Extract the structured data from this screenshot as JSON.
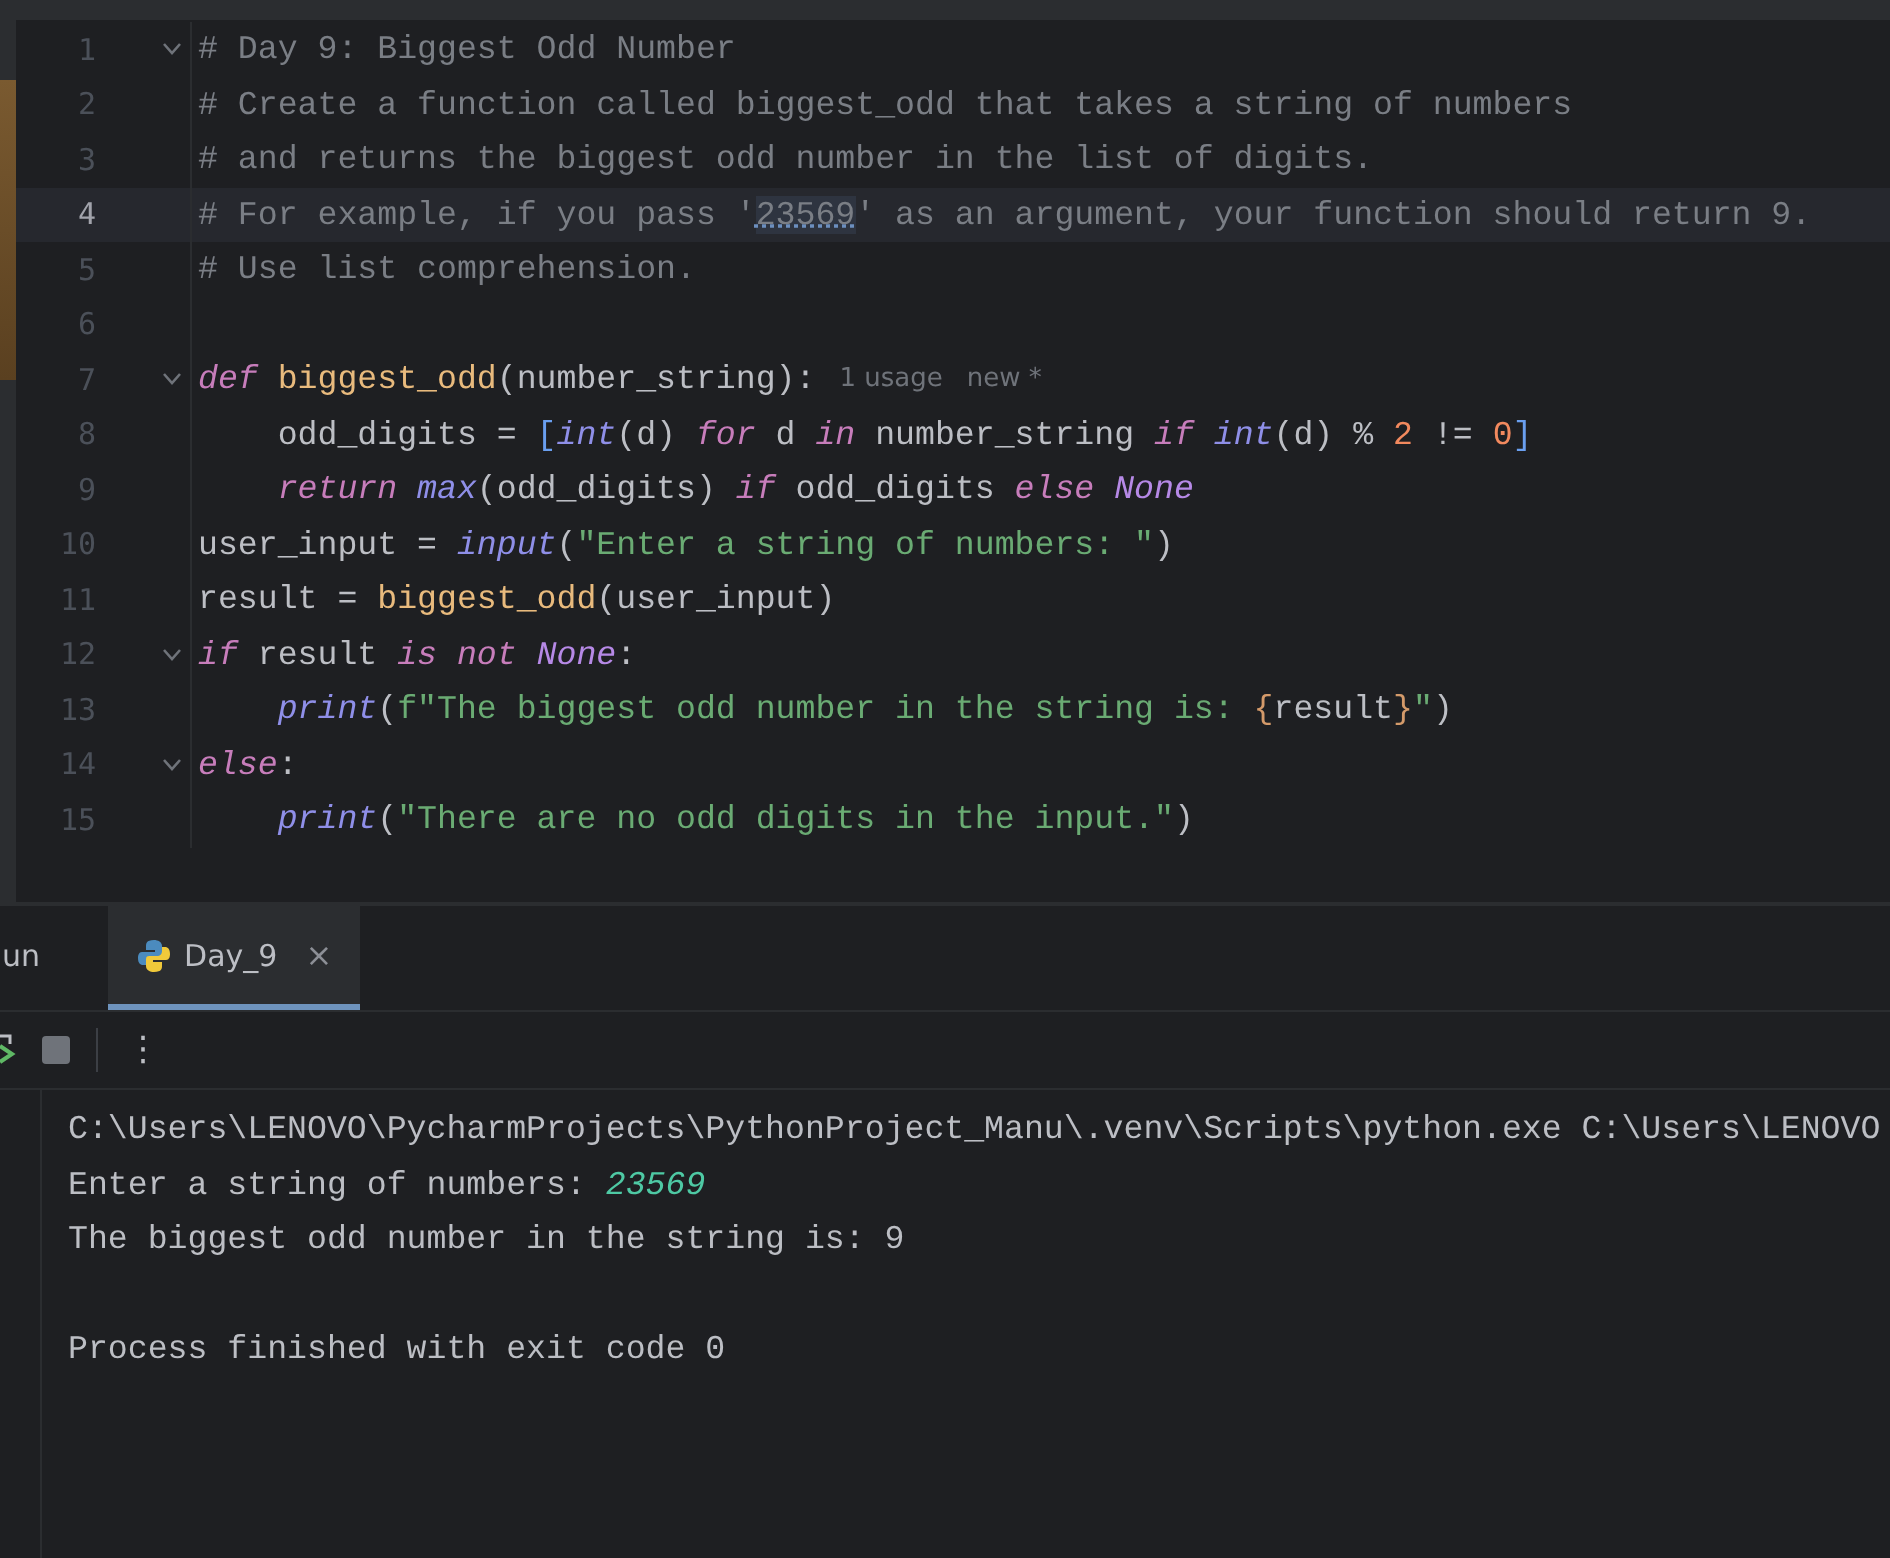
{
  "editor": {
    "lines": [
      {
        "number": "1",
        "fold": true,
        "current": false,
        "tokens": [
          {
            "kind": "comment",
            "text": "# Day 9: Biggest Odd Number"
          }
        ]
      },
      {
        "number": "2",
        "fold": false,
        "current": false,
        "tokens": [
          {
            "kind": "comment",
            "text": "# Create a function called biggest_odd that takes a string of numbers"
          }
        ]
      },
      {
        "number": "3",
        "fold": false,
        "current": false,
        "tokens": [
          {
            "kind": "comment",
            "text": "# and returns the biggest odd number in the list of digits."
          }
        ]
      },
      {
        "number": "4",
        "fold": false,
        "current": true,
        "tokens": [
          {
            "kind": "comment",
            "text": "# For example, if you pass '"
          },
          {
            "kind": "mark",
            "text": "23569"
          },
          {
            "kind": "comment",
            "text": "' as an argument, your function should return 9."
          }
        ]
      },
      {
        "number": "5",
        "fold": false,
        "current": false,
        "tokens": [
          {
            "kind": "comment",
            "text": "# Use list comprehension."
          }
        ]
      },
      {
        "number": "6",
        "fold": false,
        "current": false
      },
      {
        "number": "7",
        "fold": true,
        "current": false,
        "tokens": [
          {
            "kind": "keyword",
            "text": "def "
          },
          {
            "kind": "funcname",
            "text": "biggest_odd"
          },
          {
            "kind": "plain",
            "text": "(number_string):"
          }
        ],
        "hints": [
          "1 usage",
          "new *"
        ]
      },
      {
        "number": "8",
        "fold": false,
        "current": false,
        "indented": true,
        "tokens": [
          {
            "kind": "plain",
            "text": "odd_digits = "
          },
          {
            "kind": "bracket",
            "text": "["
          },
          {
            "kind": "builtin",
            "text": "int"
          },
          {
            "kind": "plain",
            "text": "(d) "
          },
          {
            "kind": "keyword",
            "text": "for"
          },
          {
            "kind": "plain",
            "text": " d "
          },
          {
            "kind": "keyword",
            "text": "in"
          },
          {
            "kind": "plain",
            "text": " number_string "
          },
          {
            "kind": "keyword",
            "text": "if "
          },
          {
            "kind": "builtin",
            "text": "int"
          },
          {
            "kind": "plain",
            "text": "(d) % "
          },
          {
            "kind": "number",
            "text": "2"
          },
          {
            "kind": "plain",
            "text": " != "
          },
          {
            "kind": "number",
            "text": "0"
          },
          {
            "kind": "bracket",
            "text": "]"
          }
        ]
      },
      {
        "number": "9",
        "fold": false,
        "current": false,
        "indented": true,
        "tokens": [
          {
            "kind": "keyword",
            "text": "return "
          },
          {
            "kind": "builtin",
            "text": "max"
          },
          {
            "kind": "plain",
            "text": "(odd_digits) "
          },
          {
            "kind": "keyword",
            "text": "if"
          },
          {
            "kind": "plain",
            "text": " odd_digits "
          },
          {
            "kind": "keyword",
            "text": "else "
          },
          {
            "kind": "constant",
            "text": "None"
          }
        ]
      },
      {
        "number": "10",
        "fold": false,
        "current": false,
        "tokens": [
          {
            "kind": "plain",
            "text": "user_input = "
          },
          {
            "kind": "builtin",
            "text": "input"
          },
          {
            "kind": "plain",
            "text": "("
          },
          {
            "kind": "string",
            "text": "\"Enter a string of numbers: \""
          },
          {
            "kind": "plain",
            "text": ")"
          }
        ]
      },
      {
        "number": "11",
        "fold": false,
        "current": false,
        "tokens": [
          {
            "kind": "plain",
            "text": "result = "
          },
          {
            "kind": "funcname",
            "text": "biggest_odd"
          },
          {
            "kind": "plain",
            "text": "(user_input)"
          }
        ]
      },
      {
        "number": "12",
        "fold": true,
        "current": false,
        "tokens": [
          {
            "kind": "keyword",
            "text": "if"
          },
          {
            "kind": "plain",
            "text": " result "
          },
          {
            "kind": "keyword",
            "text": "is not "
          },
          {
            "kind": "constant",
            "text": "None"
          },
          {
            "kind": "plain",
            "text": ":"
          }
        ]
      },
      {
        "number": "13",
        "fold": false,
        "current": false,
        "indented": true,
        "tokens": [
          {
            "kind": "builtin",
            "text": "print"
          },
          {
            "kind": "plain",
            "text": "("
          },
          {
            "kind": "string",
            "text": "f\"The biggest odd number in the string is: "
          },
          {
            "kind": "brace",
            "text": "{"
          },
          {
            "kind": "plain",
            "text": "result"
          },
          {
            "kind": "brace",
            "text": "}"
          },
          {
            "kind": "string",
            "text": "\""
          },
          {
            "kind": "plain",
            "text": ")"
          }
        ]
      },
      {
        "number": "14",
        "fold": true,
        "current": false,
        "tokens": [
          {
            "kind": "keyword",
            "text": "else"
          },
          {
            "kind": "plain",
            "text": ":"
          }
        ]
      },
      {
        "number": "15",
        "fold": false,
        "current": false,
        "indented": true,
        "tokens": [
          {
            "kind": "builtin",
            "text": "print"
          },
          {
            "kind": "plain",
            "text": "("
          },
          {
            "kind": "string",
            "text": "\"There are no odd digits in the input.\""
          },
          {
            "kind": "plain",
            "text": ")"
          }
        ]
      }
    ]
  },
  "run_panel": {
    "tabs": [
      {
        "label": "un",
        "selected": false
      },
      {
        "label": "Day_9",
        "selected": true,
        "close": "×"
      }
    ],
    "more": "⋮",
    "output": [
      {
        "kind": "text",
        "tokens": [
          {
            "kind": "plain",
            "text": "C:\\Users\\LENOVO\\PycharmProjects\\PythonProject_Manu\\.venv\\Scripts\\python.exe C:\\Users\\LENOVO"
          }
        ]
      },
      {
        "kind": "text",
        "tokens": [
          {
            "kind": "plain",
            "text": "Enter a string of numbers: "
          },
          {
            "kind": "input",
            "text": "23569"
          }
        ]
      },
      {
        "kind": "text",
        "tokens": [
          {
            "kind": "plain",
            "text": "The biggest odd number in the string is: 9"
          }
        ]
      },
      {
        "kind": "blank"
      },
      {
        "kind": "text",
        "tokens": [
          {
            "kind": "plain",
            "text": "Process finished with exit code 0"
          }
        ]
      }
    ]
  }
}
